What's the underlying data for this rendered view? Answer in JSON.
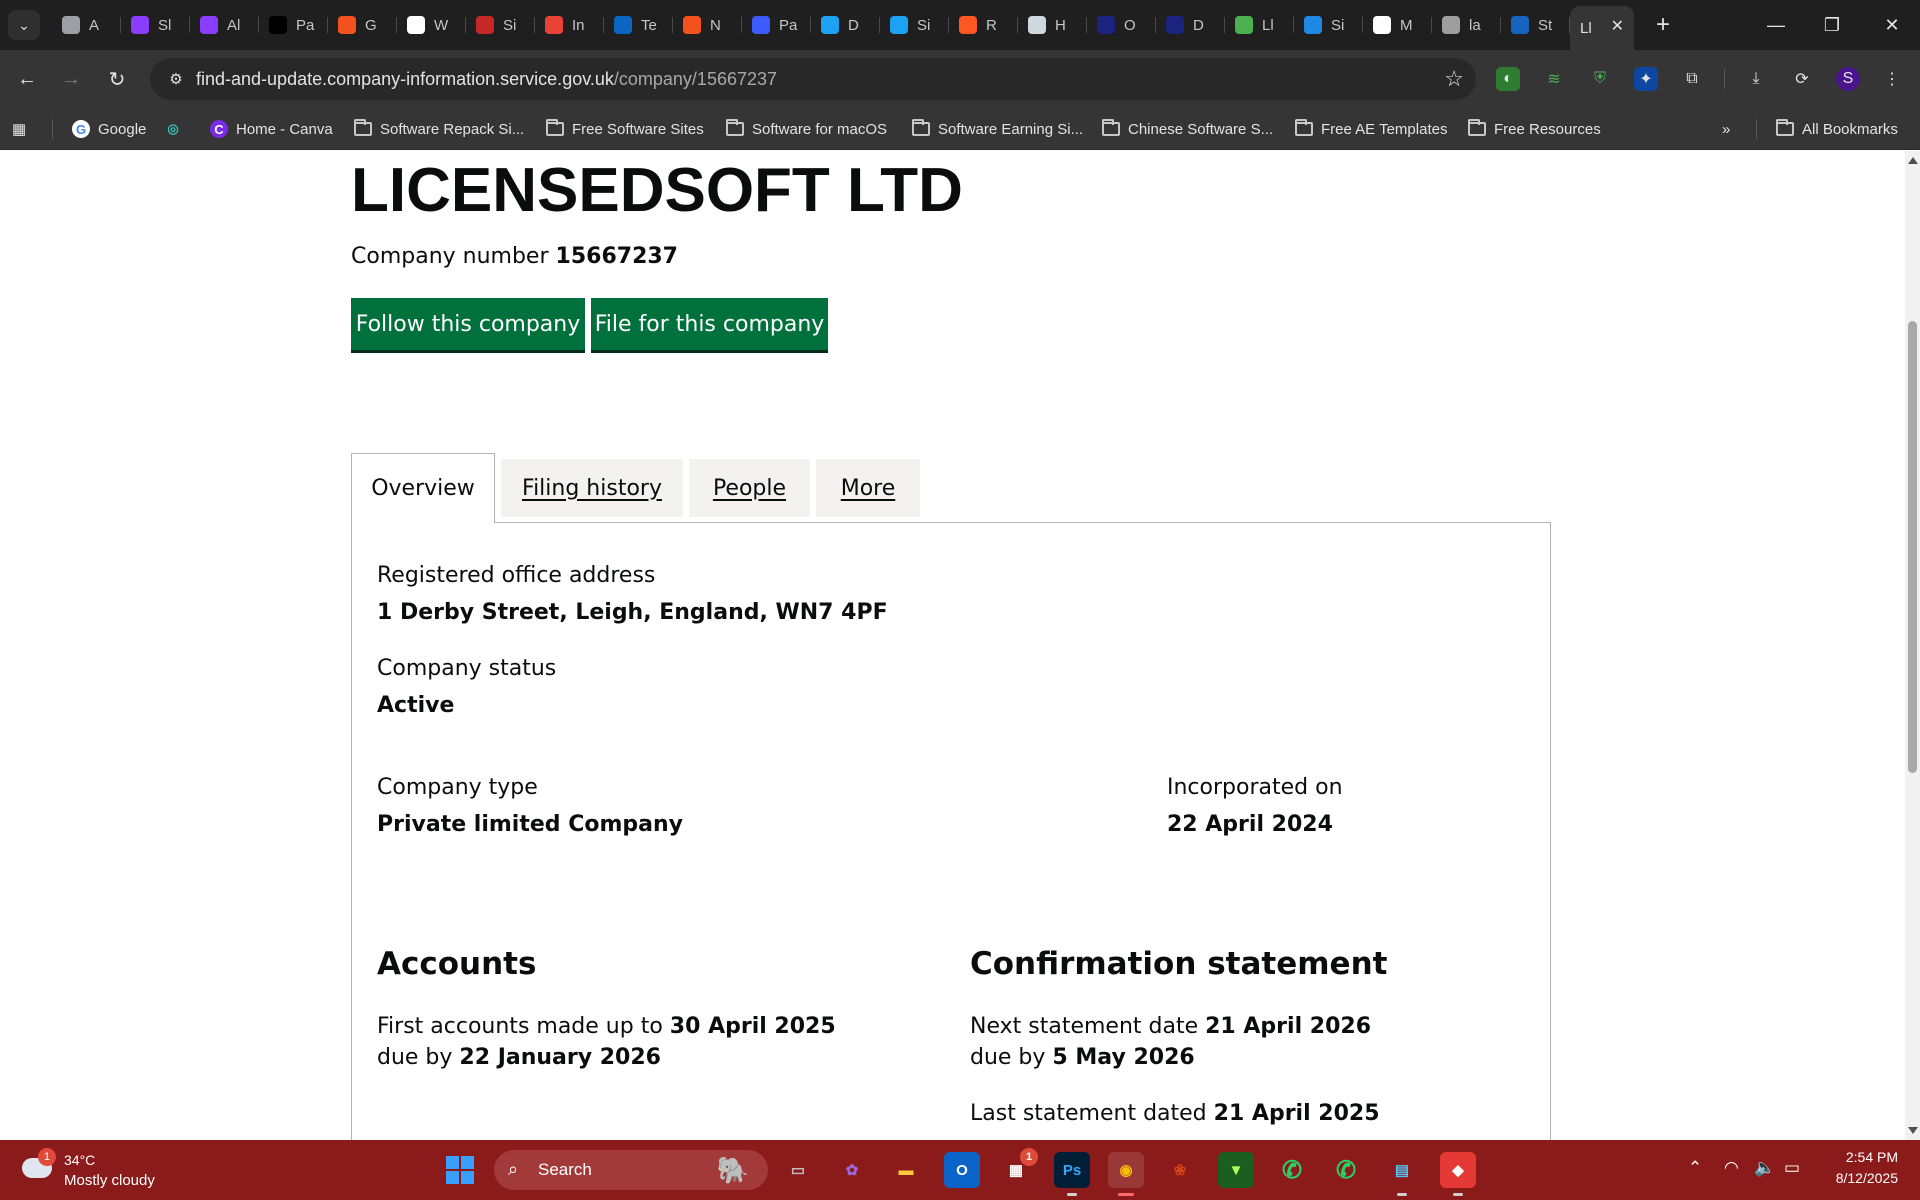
{
  "browser": {
    "tabs": [
      {
        "label": "A",
        "icon": "chrome-icon",
        "color": "#9aa0a6"
      },
      {
        "label": "Sl",
        "icon": "s-logo-icon",
        "color": "#8b3dff"
      },
      {
        "label": "Al",
        "icon": "s-logo-icon",
        "color": "#8b3dff"
      },
      {
        "label": "Pa",
        "icon": "p-logo-icon",
        "color": "#000000"
      },
      {
        "label": "G",
        "icon": "g-logo-icon",
        "color": "#f4511e"
      },
      {
        "label": "W",
        "icon": "google-icon",
        "color": "#ffffff"
      },
      {
        "label": "Si",
        "icon": "sign-icon",
        "color": "#c62828"
      },
      {
        "label": "In",
        "icon": "gmail-icon",
        "color": "#ea4335"
      },
      {
        "label": "Te",
        "icon": "onedrive-icon",
        "color": "#0a66c2"
      },
      {
        "label": "N",
        "icon": "n-logo-icon",
        "color": "#f4511e"
      },
      {
        "label": "Pa",
        "icon": "p-circle-icon",
        "color": "#3d5afe"
      },
      {
        "label": "D",
        "icon": "bird-icon",
        "color": "#1da1f2"
      },
      {
        "label": "Si",
        "icon": "bird-icon",
        "color": "#1da1f2"
      },
      {
        "label": "R",
        "icon": "r-logo-icon",
        "color": "#ff5722"
      },
      {
        "label": "H",
        "icon": "astronaut-icon",
        "color": "#cfd8dc"
      },
      {
        "label": "O",
        "icon": "u-shield-icon",
        "color": "#1a237e"
      },
      {
        "label": "D",
        "icon": "u-shield-icon",
        "color": "#1a237e"
      },
      {
        "label": "Ll",
        "icon": "ez-logo-icon",
        "color": "#4caf50"
      },
      {
        "label": "Si",
        "icon": "s-script-icon",
        "color": "#1e88e5"
      },
      {
        "label": "M",
        "icon": "openai-icon",
        "color": "#ffffff"
      },
      {
        "label": "la",
        "icon": "doc-thumb-icon",
        "color": "#9e9e9e"
      },
      {
        "label": "St",
        "icon": "pattern-icon",
        "color": "#1565c0"
      },
      {
        "label": "Ll",
        "icon": "",
        "color": "#353535"
      }
    ],
    "address": {
      "host": "find-and-update.company-information.service.gov.uk",
      "path": "/company/15667237"
    },
    "bookmarks": [
      {
        "label": "Google",
        "type": "google"
      },
      {
        "label": "",
        "type": "spiral"
      },
      {
        "label": "Home - Canva",
        "type": "canva"
      },
      {
        "label": "Software Repack Si...",
        "type": "folder"
      },
      {
        "label": "Free Software Sites",
        "type": "folder"
      },
      {
        "label": "Software for macOS",
        "type": "folder"
      },
      {
        "label": "Software Earning Si...",
        "type": "folder"
      },
      {
        "label": "Chinese Software S...",
        "type": "folder"
      },
      {
        "label": "Free AE Templates",
        "type": "folder"
      },
      {
        "label": "Free Resources",
        "type": "folder"
      }
    ],
    "all_bookmarks": "All Bookmarks",
    "overflow_glyph": "»"
  },
  "company": {
    "name": "LICENSEDSOFT LTD",
    "number_label": "Company number",
    "number": "15667237",
    "follow_button": "Follow this company",
    "file_button": "File for this company"
  },
  "page_tabs": [
    {
      "label": "Overview",
      "selected": true
    },
    {
      "label": "Filing history",
      "selected": false
    },
    {
      "label": "People",
      "selected": false
    },
    {
      "label": "More",
      "selected": false
    }
  ],
  "overview": {
    "address_label": "Registered office address",
    "address_value": "1 Derby Street, Leigh, England, WN7 4PF",
    "status_label": "Company status",
    "status_value": "Active",
    "type_label": "Company type",
    "type_value": "Private limited Company",
    "incorporated_label": "Incorporated on",
    "incorporated_value": "22 April 2024"
  },
  "accounts": {
    "heading": "Accounts",
    "line1_prefix": "First accounts made up to",
    "line1_value": "30 April 2025",
    "line2_prefix": "due by",
    "line2_value": "22 January 2026"
  },
  "confirmation": {
    "heading": "Confirmation statement",
    "line1_prefix": "Next statement date",
    "line1_value": "21 April 2026",
    "line2_prefix": "due by",
    "line2_value": "5 May 2026",
    "line3_prefix": "Last statement dated",
    "line3_value": "21 April 2025"
  },
  "taskbar": {
    "weather_badge": "1",
    "temperature": "34°C",
    "condition": "Mostly cloudy",
    "search_label": "Search",
    "store_badge": "1",
    "time": "2:54 PM",
    "date": "8/12/2025"
  }
}
